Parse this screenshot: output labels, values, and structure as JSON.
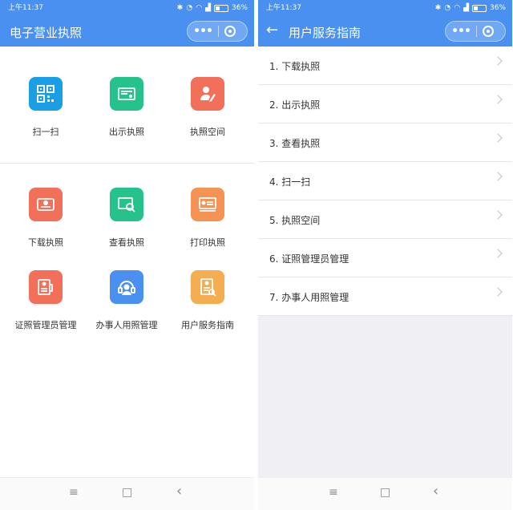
{
  "left": {
    "status": {
      "time": "上午11:37",
      "battery": "36%"
    },
    "title": "电子营业执照",
    "grid_top": [
      {
        "label": "扫一扫",
        "icon": "qr-scan-icon",
        "color": "#1a9ee6"
      },
      {
        "label": "出示执照",
        "icon": "present-license-icon",
        "color": "#26c28b"
      },
      {
        "label": "执照空间",
        "icon": "license-space-icon",
        "color": "#f2705a"
      }
    ],
    "grid_bottom": [
      {
        "label": "下载执照",
        "icon": "download-license-icon",
        "color": "#f2705a"
      },
      {
        "label": "查看执照",
        "icon": "view-license-icon",
        "color": "#26c28b"
      },
      {
        "label": "打印执照",
        "icon": "print-license-icon",
        "color": "#f49354"
      },
      {
        "label": "证照管理员管理",
        "icon": "admin-manage-icon",
        "color": "#f2705a"
      },
      {
        "label": "办事人用照管理",
        "icon": "agent-manage-icon",
        "color": "#4a90f0"
      },
      {
        "label": "用户服务指南",
        "icon": "user-guide-icon",
        "color": "#f5ad52"
      }
    ]
  },
  "right": {
    "status": {
      "time": "上午11:37",
      "battery": "36%"
    },
    "title": "用户服务指南",
    "items": [
      "1. 下载执照",
      "2. 出示执照",
      "3. 查看执照",
      "4. 扫一扫",
      "5. 执照空间",
      "6. 证照管理员管理",
      "7. 办事人用照管理"
    ]
  },
  "nav": {
    "menu": "≡",
    "home": "□",
    "back": "‹"
  },
  "capsule": {
    "more": "•••"
  }
}
